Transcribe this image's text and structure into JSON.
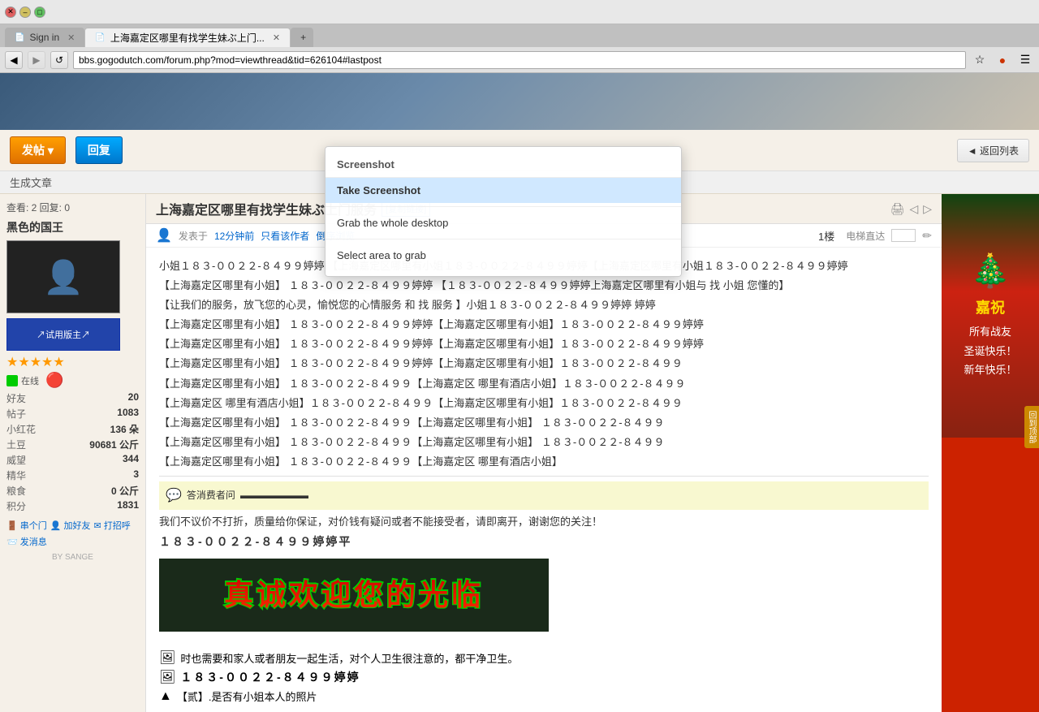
{
  "browser": {
    "tabs": [
      {
        "label": "Sign in",
        "active": false,
        "icon": "📄"
      },
      {
        "label": "上海嘉定区哪里有找学生妹ぶ上门...",
        "active": true,
        "icon": "📄"
      }
    ],
    "url": "bbs.gogodutch.com/forum.php?mod=viewthread&tid=626104#lastpost",
    "back_disabled": false,
    "forward_disabled": true
  },
  "toolbar": {
    "post_label": "发帖 ▾",
    "reply_label": "回复",
    "back_label": "◄ 返回列表",
    "gen_article": "生成文章"
  },
  "thread": {
    "stats": "查看: 2  回复: 0",
    "title": "上海嘉定区哪里有找学生妹ぶ上门服务",
    "tag": "[复制链接]",
    "meta_posted": "发表于",
    "meta_time": "12分钟前",
    "meta_view_author": "只看该作者",
    "meta_reverse": "倒序浏览",
    "post_number": "1楼",
    "elevator": "电梯直达",
    "content_lines": [
      "小姐１８３-００２２-８４９９婷婷 【上海嘉定区哪里有小姐１８３-００２２-８４９９婷婷【上海嘉定区哪里有小姐１８３-００２２-８４９９婷婷",
      "【上海嘉定区哪里有小姐】 １８３-００２２-８４９９婷婷 【１８３-００２２-８４９９婷婷上海嘉定区哪里有小姐与 找 小姐 您懂的】",
      "【让我们的服务，放飞您的心灵，愉悦您的心情服务 和 找 服务 】小姐１８３-００２２-８４９９婷婷 婷婷",
      "【上海嘉定区哪里有小姐】 １８３-００２２-８４９９婷婷【上海嘉定区哪里有小姐】１８３-００２２-８４９９婷婷",
      "【上海嘉定区哪里有小姐】 １８３-００２２-８４９９婷婷【上海嘉定区哪里有小姐】１８３-００２２-８４９９婷婷",
      "【上海嘉定区哪里有小姐】 １８３-００２２-８４９９婷婷【上海嘉定区哪里有小姐】１８３-００２２-８４９９",
      "【上海嘉定区哪里有小姐】 １８３-００２２-８４９９【上海嘉定区 哪里有酒店小姐】１８３-００２２-８４９９",
      "【上海嘉定区 哪里有酒店小姐】１８３-００２２-８４９９【上海嘉定区哪里有小姐】１８３-００２２-８４９９",
      "【上海嘉定区哪里有小姐】 １８３-００２２-８４９９【上海嘉定区哪里有小姐】 １８３-００２２-８４９９",
      "【上海嘉定区哪里有小姐】 １８３-００２２-８４９９【上海嘉定区哪里有小姐】 １８３-００２２-８４９９",
      "【上海嘉定区哪里有小姐】 １８３-００２２-８４９９【上海嘉定区 哪里有酒店小姐】"
    ],
    "consult_label": "答消费者问",
    "notice": "我们不议价不打折，质量给你保证，对价钱有疑问或者不能接受者，请即离开，谢谢您的关注！",
    "phone": "１８３-００２２-８４９９婷婷平",
    "banner_text": "真诚欢迎您的光临",
    "footer_text": "时也需要和家人或者朋友一起生活，对个人卫生很注意的，都干净卫生。",
    "phone2": "１８３-００２２-８４９９婷婷",
    "last_label": "【贰】.是否有小姐本人的照片"
  },
  "sidebar": {
    "user": {
      "name": "黑色的国王",
      "level_label": "↗试用版主↗",
      "stars": "★★★★★",
      "stats": [
        {
          "label": "好友",
          "value": "20"
        },
        {
          "label": "帖子",
          "value": "1083"
        },
        {
          "label": "小红花",
          "value": "136 朵"
        },
        {
          "label": "土豆",
          "value": "90681 公斤"
        },
        {
          "label": "威望",
          "value": "344"
        },
        {
          "label": "精华",
          "value": "3"
        },
        {
          "label": "粮食",
          "value": "0 公斤"
        },
        {
          "label": "积分",
          "value": "1831"
        }
      ],
      "actions": [
        {
          "label": "串个门",
          "icon": "🚪"
        },
        {
          "label": "加好友",
          "icon": "👤"
        },
        {
          "label": "打招呼",
          "icon": "✉"
        },
        {
          "label": "发消息",
          "icon": "📨"
        }
      ]
    }
  },
  "screenshot_overlay": {
    "title": "Screenshot",
    "items": [
      {
        "label": "Take Screenshot",
        "highlighted": true
      },
      {
        "label": "Grab the whole desktop"
      },
      {
        "label": "Select area to grab"
      }
    ]
  },
  "right_ad": {
    "icon": "🎄",
    "title": "嘉祝",
    "lines": [
      "所有战友",
      "圣诞快乐！",
      "新年快乐！"
    ]
  },
  "scroll": {
    "label": "回到顶部"
  }
}
